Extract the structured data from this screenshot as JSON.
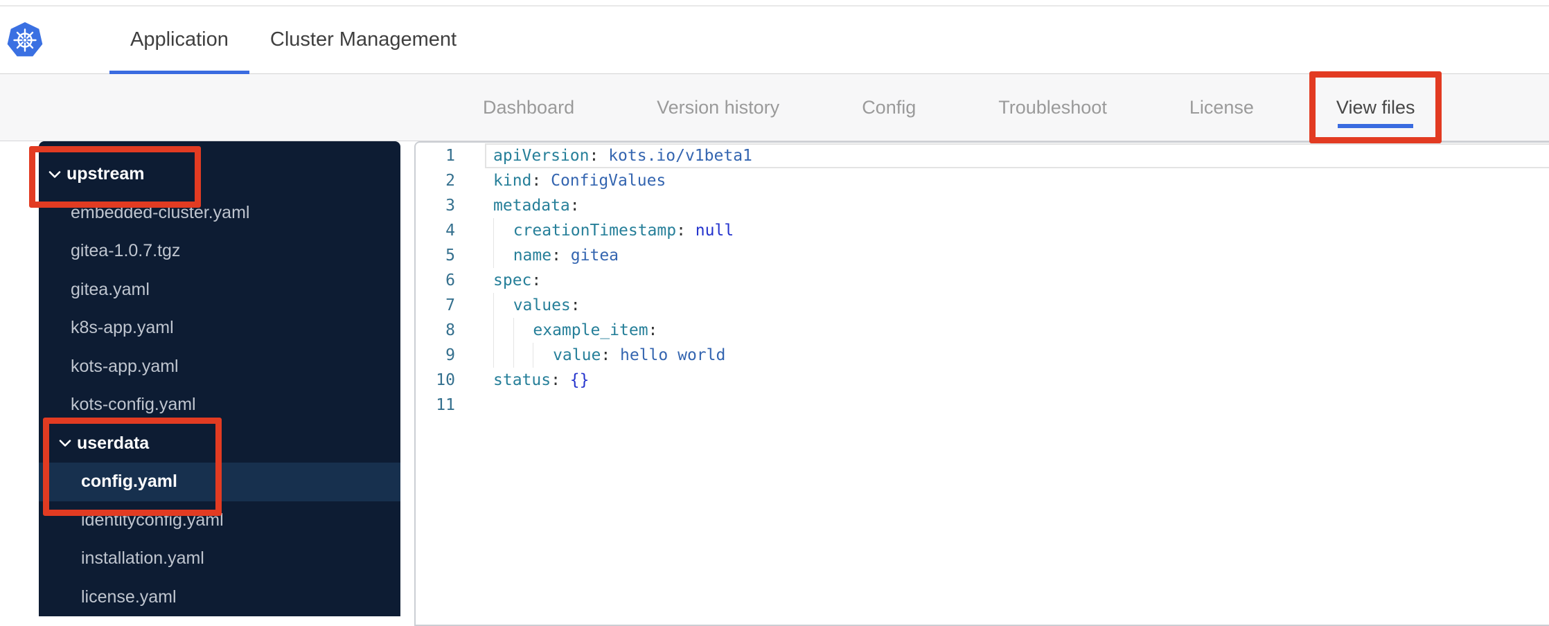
{
  "header": {
    "logo_icon": "kubernetes-logo",
    "tabs": [
      {
        "label": "Application",
        "active": true
      },
      {
        "label": "Cluster Management",
        "active": false
      }
    ]
  },
  "subnav": {
    "tabs": [
      {
        "label": "Dashboard",
        "active": false
      },
      {
        "label": "Version history",
        "active": false
      },
      {
        "label": "Config",
        "active": false
      },
      {
        "label": "Troubleshoot",
        "active": false
      },
      {
        "label": "License",
        "active": false
      },
      {
        "label": "View files",
        "active": true,
        "annotated": true
      }
    ]
  },
  "sidebar": {
    "items": [
      {
        "label": "upstream",
        "kind": "folder",
        "level": 0,
        "expanded": true,
        "annotated": true
      },
      {
        "label": "embedded-cluster.yaml",
        "kind": "file",
        "level": 1
      },
      {
        "label": "gitea-1.0.7.tgz",
        "kind": "file",
        "level": 1
      },
      {
        "label": "gitea.yaml",
        "kind": "file",
        "level": 1
      },
      {
        "label": "k8s-app.yaml",
        "kind": "file",
        "level": 1
      },
      {
        "label": "kots-app.yaml",
        "kind": "file",
        "level": 1
      },
      {
        "label": "kots-config.yaml",
        "kind": "file",
        "level": 1
      },
      {
        "label": "userdata",
        "kind": "folder",
        "level": 1,
        "expanded": true,
        "annotated": true
      },
      {
        "label": "config.yaml",
        "kind": "file",
        "level": 2,
        "selected": true,
        "annotated": true
      },
      {
        "label": "identityconfig.yaml",
        "kind": "file",
        "level": 2
      },
      {
        "label": "installation.yaml",
        "kind": "file",
        "level": 2
      },
      {
        "label": "license.yaml",
        "kind": "file",
        "level": 2
      }
    ]
  },
  "editor": {
    "language": "yaml",
    "active_line": 1,
    "lines": [
      {
        "indent": 0,
        "tokens": [
          [
            "key",
            "apiVersion"
          ],
          [
            "pun",
            ": "
          ],
          [
            "val",
            "kots.io/v1beta1"
          ]
        ]
      },
      {
        "indent": 0,
        "tokens": [
          [
            "key",
            "kind"
          ],
          [
            "pun",
            ": "
          ],
          [
            "val",
            "ConfigValues"
          ]
        ]
      },
      {
        "indent": 0,
        "tokens": [
          [
            "key",
            "metadata"
          ],
          [
            "pun",
            ":"
          ]
        ]
      },
      {
        "indent": 1,
        "tokens": [
          [
            "key",
            "creationTimestamp"
          ],
          [
            "pun",
            ": "
          ],
          [
            "kw",
            "null"
          ]
        ]
      },
      {
        "indent": 1,
        "tokens": [
          [
            "key",
            "name"
          ],
          [
            "pun",
            ": "
          ],
          [
            "val",
            "gitea"
          ]
        ]
      },
      {
        "indent": 0,
        "tokens": [
          [
            "key",
            "spec"
          ],
          [
            "pun",
            ":"
          ]
        ]
      },
      {
        "indent": 1,
        "tokens": [
          [
            "key",
            "values"
          ],
          [
            "pun",
            ":"
          ]
        ]
      },
      {
        "indent": 2,
        "tokens": [
          [
            "key",
            "example_item"
          ],
          [
            "pun",
            ":"
          ]
        ]
      },
      {
        "indent": 3,
        "tokens": [
          [
            "key",
            "value"
          ],
          [
            "pun",
            ": "
          ],
          [
            "val",
            "hello world"
          ]
        ]
      },
      {
        "indent": 0,
        "tokens": [
          [
            "key",
            "status"
          ],
          [
            "pun",
            ": "
          ],
          [
            "kw",
            "{}"
          ]
        ]
      },
      {
        "indent": 0,
        "tokens": []
      }
    ]
  },
  "colors": {
    "accent": "#3a6be0",
    "annotation": "#e23b22",
    "sidebar_bg": "#0d1c33",
    "sidebar_selected_bg": "#17304e",
    "logo_blue": "#3a70e2",
    "token_key": "#267f99",
    "token_value": "#3465b0",
    "token_keyword": "#2433cd",
    "line_number": "#35708e"
  }
}
